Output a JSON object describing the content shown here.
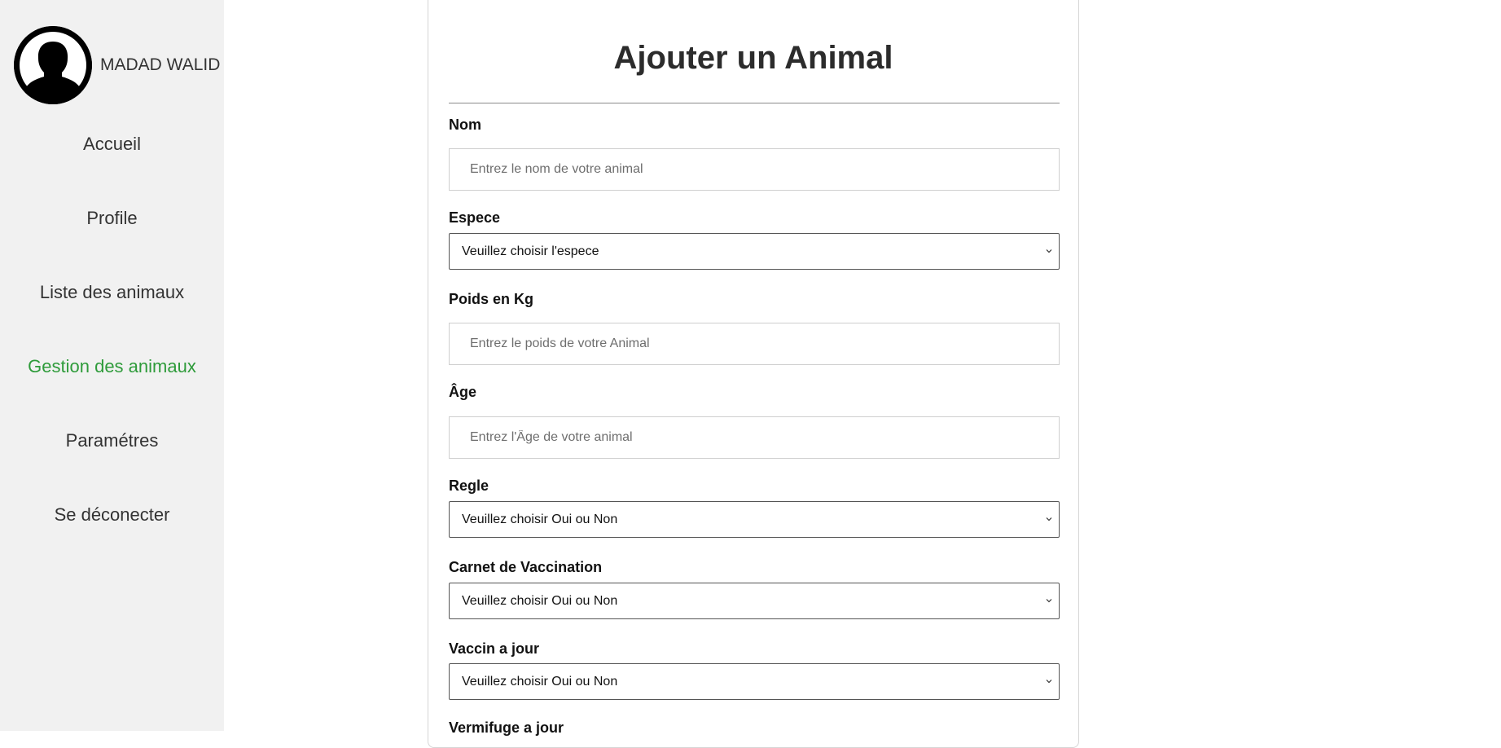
{
  "sidebar": {
    "user_name": "MADAD WALID",
    "nav": [
      {
        "label": "Accueil",
        "active": false
      },
      {
        "label": "Profile",
        "active": false
      },
      {
        "label": "Liste des animaux",
        "active": false
      },
      {
        "label": "Gestion des animaux",
        "active": true
      },
      {
        "label": "Paramétres",
        "active": false
      },
      {
        "label": "Se déconecter",
        "active": false
      }
    ],
    "active_color": "#2e9b3a"
  },
  "form": {
    "title": "Ajouter un Animal",
    "nom": {
      "label": "Nom",
      "placeholder": "Entrez le nom de votre animal",
      "value": ""
    },
    "espece": {
      "label": "Espece",
      "selected": "Veuillez choisir l'espece"
    },
    "poids": {
      "label": "Poids en Kg",
      "placeholder": "Entrez le poids de votre Animal",
      "value": ""
    },
    "age": {
      "label": "Âge",
      "placeholder": "Entrez l'Âge de votre animal",
      "value": ""
    },
    "regle": {
      "label": "Regle",
      "selected": "Veuillez choisir Oui ou Non"
    },
    "carnet": {
      "label": "Carnet de Vaccination",
      "selected": "Veuillez choisir Oui ou Non"
    },
    "vaccin": {
      "label": "Vaccin a jour",
      "selected": "Veuillez choisir Oui ou Non"
    },
    "vermifuge": {
      "label": "Vermifuge a jour"
    }
  },
  "icons": {
    "avatar": "user-silhouette-icon",
    "select_arrow": "chevron-down-icon"
  }
}
